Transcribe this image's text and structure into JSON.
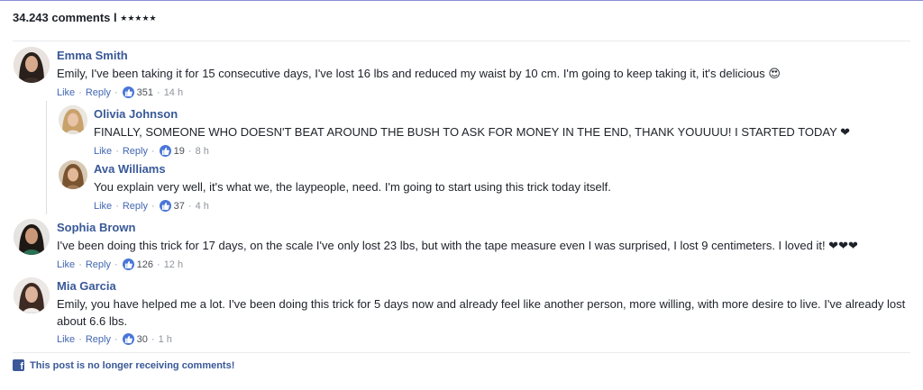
{
  "header": {
    "count_text": "34.243 comments l",
    "stars": "★★★★★"
  },
  "comments": [
    {
      "name": "Emma Smith",
      "text": "Emily, I've been taking it for 15 consecutive days, I've lost 16 lbs and reduced my waist by 10 cm. I'm going to keep taking it, it's delicious 😍",
      "like": "Like",
      "reply": "Reply",
      "likes": "351",
      "time": "14 h"
    },
    {
      "name": "Olivia Johnson",
      "text": "FINALLY, SOMEONE WHO DOESN'T BEAT AROUND THE BUSH TO ASK FOR MONEY IN THE END, THANK YOUUUU! I STARTED TODAY ❤",
      "like": "Like",
      "reply": "Reply",
      "likes": "19",
      "time": "8 h"
    },
    {
      "name": "Ava Williams",
      "text": "You explain very well, it's what we, the laypeople, need. I'm going to start using this trick today itself.",
      "like": "Like",
      "reply": "Reply",
      "likes": "37",
      "time": "4 h"
    },
    {
      "name": "Sophia Brown",
      "text": "I've been doing this trick for 17 days, on the scale I've only lost 23 lbs, but with the tape measure even I was surprised, I lost 9 centimeters. I loved it! ❤❤❤",
      "like": "Like",
      "reply": "Reply",
      "likes": "126",
      "time": "12 h"
    },
    {
      "name": "Mia Garcia",
      "text": "Emily, you have helped me a lot. I've been doing this trick for 5 days now and already feel like another person, more willing, with more desire to live. I've already lost about 6.6 lbs.",
      "like": "Like",
      "reply": "Reply",
      "likes": "30",
      "time": "1 h"
    }
  ],
  "footer": {
    "text": "This post is no longer receiving comments!"
  },
  "colors": {
    "name": "#385898",
    "link": "#4267b2",
    "like_badge": "#4a76d8",
    "facebook": "#3b5998"
  }
}
